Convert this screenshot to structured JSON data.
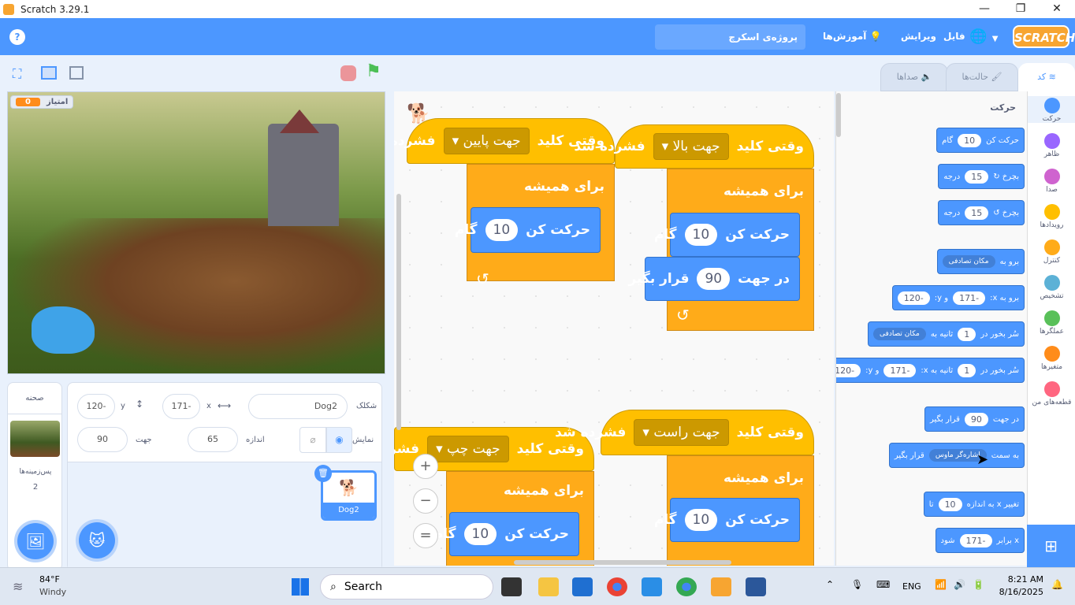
{
  "window": {
    "title": "Scratch 3.29.1",
    "minimize": "—",
    "maximize": "❐",
    "close": "✕"
  },
  "menu": {
    "help": "?",
    "language_icon": "globe",
    "file": "فایل",
    "edit": "ویرایش",
    "tutorials": "آموزش‌ها",
    "project_title": "پروژه‌ی اسکرچ",
    "logo": "SCRATCH"
  },
  "tabs": {
    "code": "کد",
    "costumes": "حالت‌ها",
    "sounds": "صداها"
  },
  "stage": {
    "monitor_label": "امتیاز",
    "monitor_value": "0"
  },
  "sprite_info": {
    "sprite_label": "شکلک",
    "sprite_name": "Dog2",
    "x_label": "x",
    "x": "-171",
    "y_label": "y",
    "y": "-120",
    "show_label": "نمایش",
    "size_label": "اندازه",
    "size": "65",
    "direction_label": "جهت",
    "direction": "90"
  },
  "sprites": [
    {
      "name": "Dog2"
    }
  ],
  "stage_panel": {
    "title": "صحنه",
    "backdrops_label": "پس‌زمینه‌ها",
    "backdrops_count": "2"
  },
  "scripts": [
    {
      "hat_when": "وقتی کلید",
      "key": "جهت پایین",
      "hat_pressed": "فشرده شد",
      "forever": "برای همیشه",
      "move": "حرکت کن",
      "steps": "10",
      "step_unit": "گام"
    },
    {
      "hat_when": "وقتی کلید",
      "key": "جهت بالا",
      "hat_pressed": "فشرده شد",
      "forever": "برای همیشه",
      "move": "حرکت کن",
      "steps": "10",
      "step_unit": "گام",
      "point": "در جهت",
      "dir": "90",
      "point_end": "قرار بگیر"
    },
    {
      "hat_when": "وقتی کلید",
      "key": "جهت چپ",
      "hat_pressed": "فشرده شد",
      "forever": "برای همیشه",
      "move": "حرکت کن",
      "steps": "10",
      "step_unit": "گام"
    },
    {
      "hat_when": "وقتی کلید",
      "key": "جهت راست",
      "hat_pressed": "فشرده شد",
      "forever": "برای همیشه",
      "move": "حرکت کن",
      "steps": "10",
      "step_unit": "گام"
    }
  ],
  "zoom": {
    "in": "+",
    "out": "−",
    "reset": "="
  },
  "palette": {
    "heading": "حرکت",
    "blocks": [
      {
        "a": "حرکت کن",
        "v1": "10",
        "b": "گام"
      },
      {
        "a": "بچرخ ↻",
        "v1": "15",
        "b": "درجه"
      },
      {
        "a": "بچرخ ↺",
        "v1": "15",
        "b": "درجه"
      },
      {
        "a": "برو به",
        "dd": "مکان تصادفی"
      },
      {
        "a": "برو به x:",
        "v1": "-171",
        "b": "و y:",
        "v2": "-120"
      },
      {
        "a": "سُر بخور در",
        "v1": "1",
        "b": "ثانیه به",
        "dd": "مکان تصادفی"
      },
      {
        "a": "سُر بخور در",
        "v1": "1",
        "b": "ثانیه به x:",
        "v2": "-171",
        "c": "و y:",
        "v3": "-120"
      },
      {
        "a": "در جهت",
        "v1": "90",
        "b": "قرار بگیر"
      },
      {
        "a": "به سمت",
        "dd": "اشاره‌گر ماوس",
        "b": "قرار بگیر"
      },
      {
        "a": "تغییر x به اندازه",
        "v1": "10",
        "b": "تا"
      },
      {
        "a": "x برابر",
        "v1": "-171",
        "b": "شود"
      }
    ]
  },
  "categories": [
    {
      "label": "حرکت",
      "color": "#4c97ff"
    },
    {
      "label": "ظاهر",
      "color": "#9966ff"
    },
    {
      "label": "صدا",
      "color": "#cf63cf"
    },
    {
      "label": "رویدادها",
      "color": "#ffbf00"
    },
    {
      "label": "کنترل",
      "color": "#ffab19"
    },
    {
      "label": "تشخیص",
      "color": "#5cb1d6"
    },
    {
      "label": "عملگرها",
      "color": "#59c059"
    },
    {
      "label": "متغیرها",
      "color": "#ff8c1a"
    },
    {
      "label": "قطعه‌های من",
      "color": "#ff6680"
    }
  ],
  "taskbar": {
    "temp": "84°F",
    "weather": "Windy",
    "search": "Search",
    "lang": "ENG",
    "time": "8:21 AM",
    "date": "8/16/2025"
  }
}
